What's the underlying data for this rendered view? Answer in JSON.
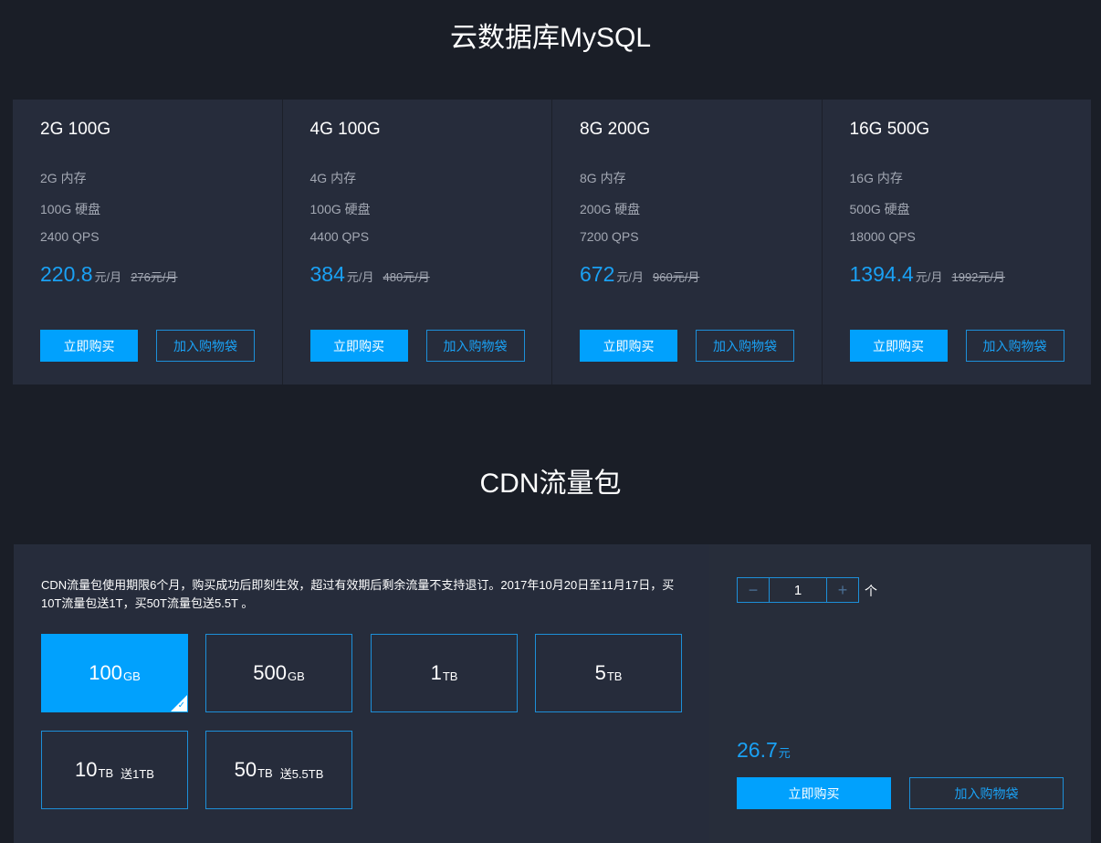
{
  "mysql": {
    "title": "云数据库MySQL",
    "plans": [
      {
        "name": "2G 100G",
        "memory": "2G 内存",
        "disk": "100G 硬盘",
        "qps": "2400 QPS",
        "price": "220.8",
        "unit": "元/月",
        "original": "276元/月",
        "buy": "立即购买",
        "cart": "加入购物袋"
      },
      {
        "name": "4G 100G",
        "memory": "4G 内存",
        "disk": "100G 硬盘",
        "qps": "4400 QPS",
        "price": "384",
        "unit": "元/月",
        "original": "480元/月",
        "buy": "立即购买",
        "cart": "加入购物袋"
      },
      {
        "name": "8G 200G",
        "memory": "8G 内存",
        "disk": "200G 硬盘",
        "qps": "7200 QPS",
        "price": "672",
        "unit": "元/月",
        "original": "960元/月",
        "buy": "立即购买",
        "cart": "加入购物袋"
      },
      {
        "name": "16G 500G",
        "memory": "16G 内存",
        "disk": "500G 硬盘",
        "qps": "18000 QPS",
        "price": "1394.4",
        "unit": "元/月",
        "original": "1992元/月",
        "buy": "立即购买",
        "cart": "加入购物袋"
      }
    ]
  },
  "cdn": {
    "title": "CDN流量包",
    "description": "CDN流量包使用期限6个月，购买成功后即刻生效，超过有效期后剩余流量不支持退订。2017年10月20日至11月17日，买10T流量包送1T，买50T流量包送5.5T 。",
    "packages": [
      {
        "num": "100",
        "unit": "GB",
        "gift": "",
        "selected": true
      },
      {
        "num": "500",
        "unit": "GB",
        "gift": "",
        "selected": false
      },
      {
        "num": "1",
        "unit": "TB",
        "gift": "",
        "selected": false
      },
      {
        "num": "5",
        "unit": "TB",
        "gift": "",
        "selected": false
      },
      {
        "num": "10",
        "unit": "TB",
        "gift": "送1TB",
        "selected": false
      },
      {
        "num": "50",
        "unit": "TB",
        "gift": "送5.5TB",
        "selected": false
      }
    ],
    "stepper": {
      "minus": "−",
      "value": "1",
      "plus": "+",
      "unit": "个"
    },
    "price": "26.7",
    "price_unit": "元",
    "buy": "立即购买",
    "cart": "加入购物袋"
  },
  "colors": {
    "accent": "#01a1fd",
    "price": "#1aa1f4",
    "background": "#1a1e27",
    "panel": "#262c3b"
  }
}
